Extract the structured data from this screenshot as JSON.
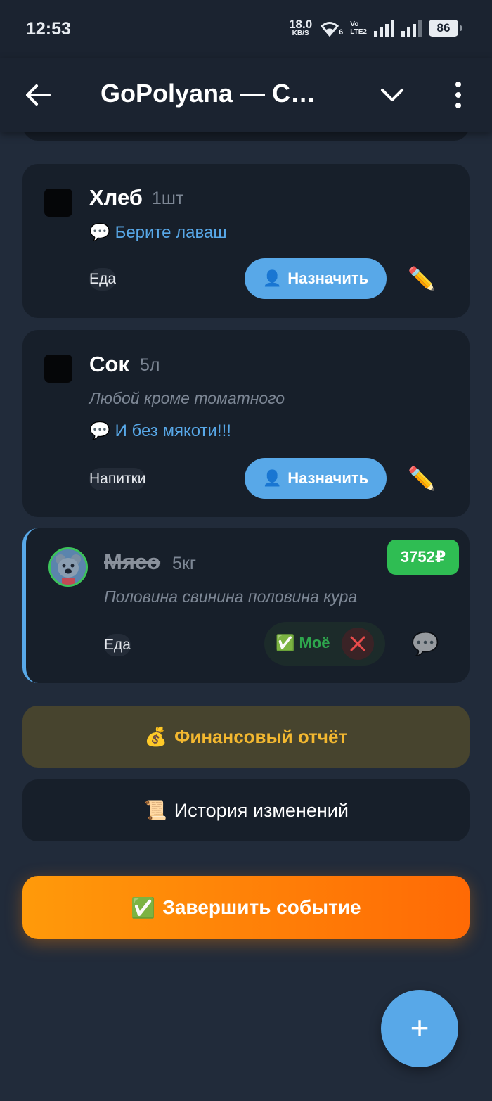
{
  "status_bar": {
    "time": "12:53",
    "net_speed": "18.0",
    "net_unit": "KB/S",
    "wifi_sub": "6",
    "volte_top": "Vo",
    "volte_bottom": "LTE2",
    "battery": "86"
  },
  "app_bar": {
    "title": "GoPolyana — Сп...",
    "icons": {
      "back": "arrow-left-icon",
      "dropdown": "chevron-down-icon",
      "more": "more-vertical-icon"
    }
  },
  "items": [
    {
      "name": "Хлеб",
      "qty": "1шт",
      "comment_icon": "💬",
      "comment": "Берите лаваш",
      "category": "Еда",
      "assign_icon": "👤",
      "assign_label": "Назначить",
      "edit_icon": "✏️"
    },
    {
      "name": "Сок",
      "qty": "5л",
      "description": "Любой кроме томатного",
      "comment_icon": "💬",
      "comment": "И без мякоти!!!",
      "category": "Напитки",
      "assign_icon": "👤",
      "assign_label": "Назначить",
      "edit_icon": "✏️"
    },
    {
      "name": "Мясо",
      "qty": "5кг",
      "description": "Половина свинина половина кура",
      "category": "Еда",
      "price": "3752₽",
      "mine_label": "✅ Моё",
      "cancel_icon": "✕",
      "comment_icon": "💬"
    }
  ],
  "actions": {
    "finance_icon": "💰",
    "finance_label": "Финансовый отчёт",
    "history_icon": "📜",
    "history_label": "История изменений",
    "finish_icon": "✅",
    "finish_label": "Завершить событие",
    "fab_label": "+"
  },
  "colors": {
    "background": "#212b3a",
    "card": "#171f2a",
    "accent_blue": "#58a8e8",
    "price_green": "#2fbd53",
    "finance_gold": "#f3b830",
    "finish_orange": "#ff8a08"
  }
}
